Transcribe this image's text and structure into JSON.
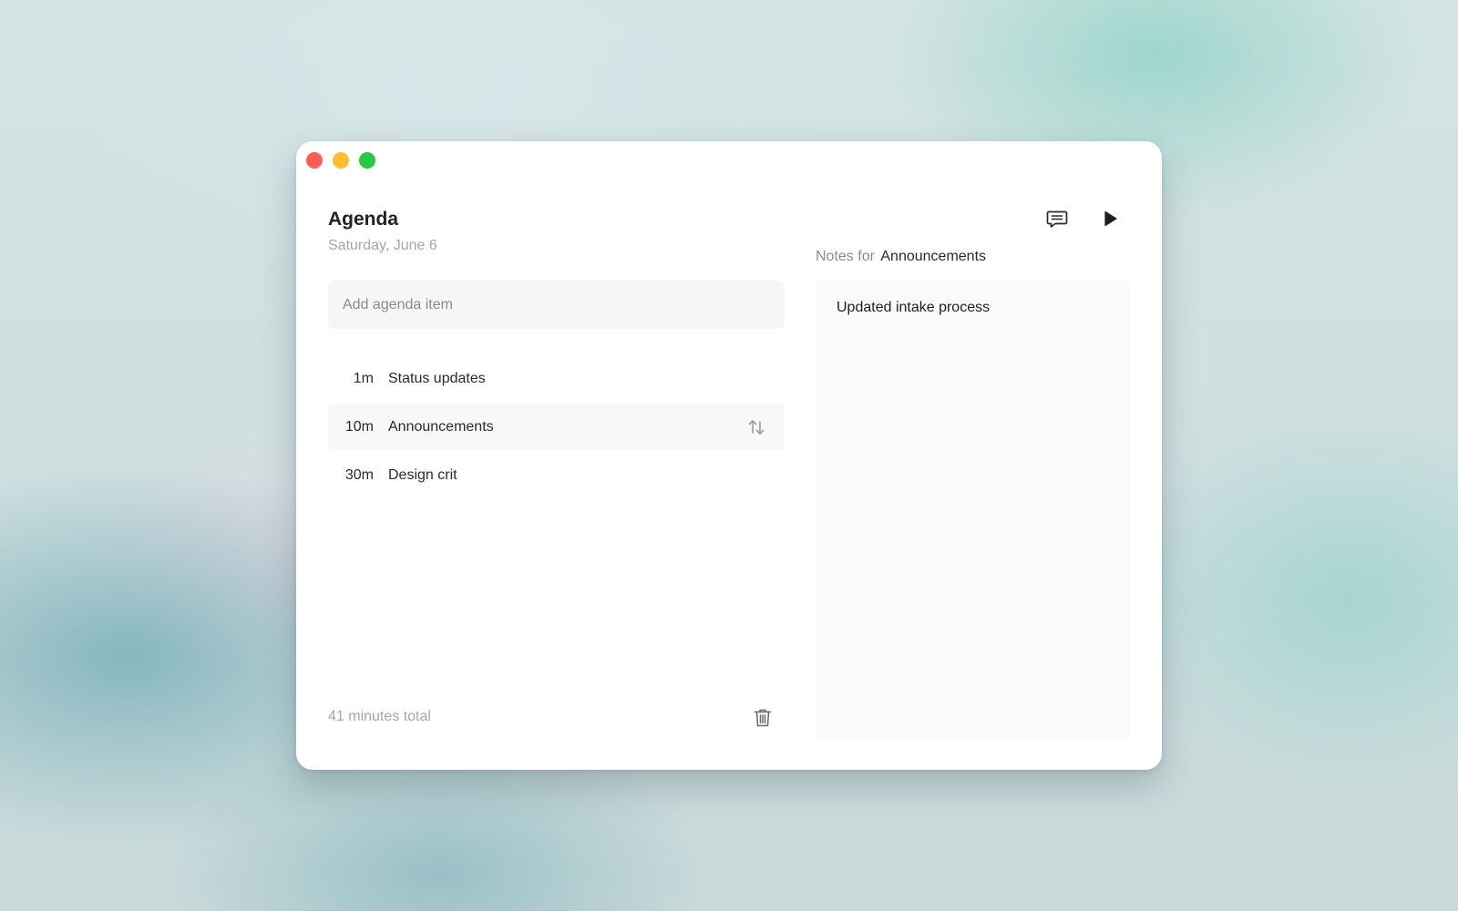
{
  "window": {
    "traffic_lights": {
      "close_color": "#ff5f57",
      "minimize_color": "#febc2e",
      "maximize_color": "#28c840"
    }
  },
  "header": {
    "title": "Agenda",
    "date": "Saturday, June 6"
  },
  "toolbar": {
    "notes_icon": "speech-bubble-icon",
    "play_icon": "play-icon"
  },
  "add_item": {
    "placeholder": "Add agenda item",
    "value": ""
  },
  "agenda": {
    "items": [
      {
        "duration": "1m",
        "title": "Status updates",
        "selected": false
      },
      {
        "duration": "10m",
        "title": "Announcements",
        "selected": true
      },
      {
        "duration": "30m",
        "title": "Design crit",
        "selected": false
      }
    ],
    "reorder_icon": "reorder-arrows-icon"
  },
  "footer": {
    "total": "41 minutes total",
    "delete_icon": "trash-icon"
  },
  "notes": {
    "label_prefix": "Notes for",
    "label_target": "Announcements",
    "content": "Updated intake process"
  }
}
